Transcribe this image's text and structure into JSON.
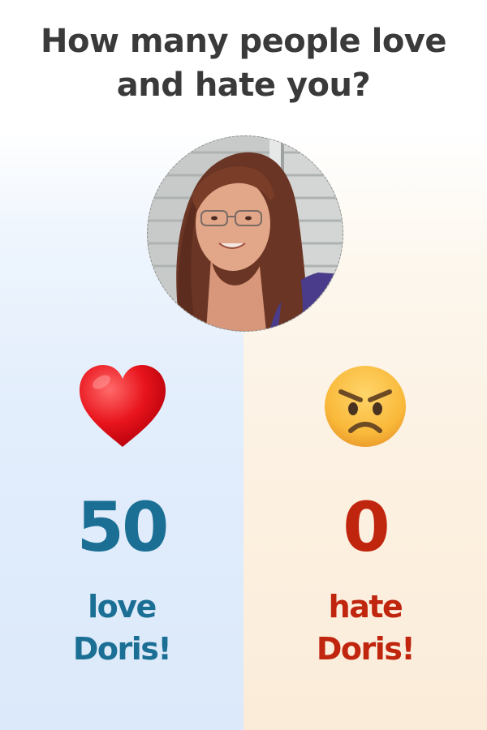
{
  "headline": {
    "line1": "How many people love",
    "line2": "and hate you?"
  },
  "profile": {
    "photo": "portrait of Doris"
  },
  "love": {
    "icon": "red-heart",
    "count": "50",
    "label_line1": "love",
    "label_line2": "Doris!",
    "color": "#1b6f95"
  },
  "hate": {
    "icon": "angry-face",
    "count": "0",
    "label_line1": "hate",
    "label_line2": "Doris!",
    "color": "#c0250e"
  },
  "colors": {
    "headline": "#3a3a3a",
    "left_panel": "#dbe9fa",
    "right_panel": "#fbecd9"
  }
}
